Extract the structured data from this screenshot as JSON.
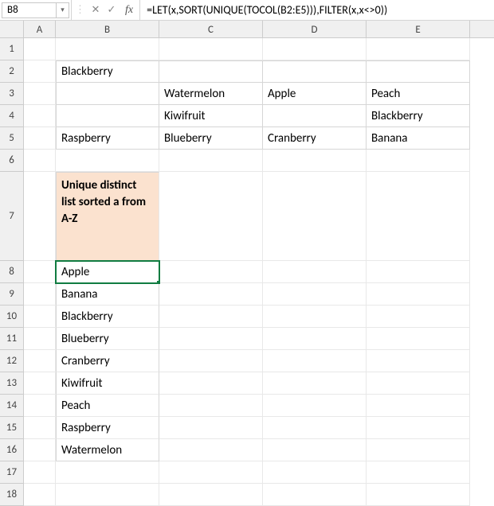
{
  "namebox": {
    "value": "B8"
  },
  "formula_bar": {
    "fx_label": "fx",
    "cancel_glyph": "✕",
    "enter_glyph": "✓",
    "formula": "=LET(x,SORT(UNIQUE(TOCOL(B2:E5))),FILTER(x,x<>0))"
  },
  "columns": [
    "A",
    "B",
    "C",
    "D",
    "E"
  ],
  "row_labels": [
    "1",
    "2",
    "3",
    "4",
    "5",
    "6",
    "7",
    "8",
    "9",
    "10",
    "11",
    "12",
    "13",
    "14",
    "15",
    "16",
    "17",
    "18"
  ],
  "table_B2_E5": {
    "rows": [
      {
        "B": "Blackberry",
        "C": "",
        "D": "",
        "E": ""
      },
      {
        "B": "",
        "C": "Watermelon",
        "D": "Apple",
        "E": "Peach"
      },
      {
        "B": "",
        "C": "Kiwifruit",
        "D": "",
        "E": "Blackberry"
      },
      {
        "B": "Raspberry",
        "C": "Blueberry",
        "D": "Cranberry",
        "E": "Banana"
      }
    ]
  },
  "header_B7": "Unique distinct list sorted a from A-Z",
  "results_B": [
    "Apple",
    "Banana",
    "Blackberry",
    "Blueberry",
    "Cranberry",
    "Kiwifruit",
    "Peach",
    "Raspberry",
    "Watermelon"
  ],
  "active_cell": "B8"
}
